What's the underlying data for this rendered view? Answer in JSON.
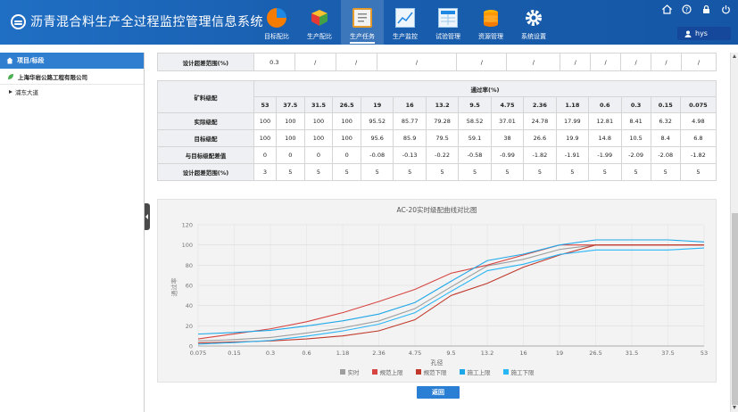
{
  "header": {
    "title": "沥青混合料生产全过程监控管理信息系统",
    "nav": [
      {
        "label": "目标配比",
        "icon": "pie-chart-icon"
      },
      {
        "label": "生产配比",
        "icon": "cube-icon"
      },
      {
        "label": "生产任务",
        "icon": "clipboard-icon"
      },
      {
        "label": "生产监控",
        "icon": "line-chart-icon"
      },
      {
        "label": "试验管理",
        "icon": "table-icon"
      },
      {
        "label": "资源管理",
        "icon": "database-icon"
      },
      {
        "label": "系统设置",
        "icon": "gear-icon"
      }
    ],
    "user": "hys"
  },
  "sidebar": {
    "title": "项目/标段",
    "org": "上海华岩公路工程有限公司",
    "items": [
      {
        "label": "浦东大道"
      }
    ]
  },
  "top_row": {
    "label": "设计超差范围(%)",
    "values": [
      "0.3",
      "/",
      "/",
      "/",
      "/",
      "/",
      "/",
      "/",
      "/",
      "/",
      "/"
    ]
  },
  "grading_table": {
    "head_left": "矿料级配",
    "head_group": "通过率(%)",
    "sieves": [
      "53",
      "37.5",
      "31.5",
      "26.5",
      "19",
      "16",
      "13.2",
      "9.5",
      "4.75",
      "2.36",
      "1.18",
      "0.6",
      "0.3",
      "0.15",
      "0.075"
    ],
    "rows": [
      {
        "label": "实际级配",
        "values": [
          "100",
          "100",
          "100",
          "100",
          "95.52",
          "85.77",
          "79.28",
          "58.52",
          "37.01",
          "24.78",
          "17.99",
          "12.81",
          "8.41",
          "6.32",
          "4.98"
        ]
      },
      {
        "label": "目标级配",
        "values": [
          "100",
          "100",
          "100",
          "100",
          "95.6",
          "85.9",
          "79.5",
          "59.1",
          "38",
          "26.6",
          "19.9",
          "14.8",
          "10.5",
          "8.4",
          "6.8"
        ]
      },
      {
        "label": "与目标级配差值",
        "values": [
          "0",
          "0",
          "0",
          "0",
          "-0.08",
          "-0.13",
          "-0.22",
          "-0.58",
          "-0.99",
          "-1.82",
          "-1.91",
          "-1.99",
          "-2.09",
          "-2.08",
          "-1.82"
        ]
      },
      {
        "label": "设计超差范围(%)",
        "values": [
          "3",
          "5",
          "5",
          "5",
          "5",
          "5",
          "5",
          "5",
          "5",
          "5",
          "5",
          "5",
          "5",
          "5",
          "5"
        ]
      }
    ]
  },
  "chart_data": {
    "type": "line",
    "title": "AC-20实时级配曲线对比图",
    "xlabel": "孔径",
    "ylabel": "通过率",
    "categories": [
      "0.075",
      "0.15",
      "0.3",
      "0.6",
      "1.18",
      "2.36",
      "4.75",
      "9.5",
      "13.2",
      "16",
      "19",
      "26.5",
      "31.5",
      "37.5",
      "53"
    ],
    "ylim": [
      0,
      120
    ],
    "yticks": [
      0,
      20,
      40,
      60,
      80,
      100,
      120
    ],
    "series": [
      {
        "name": "实时",
        "color": "#9e9e9e",
        "values": [
          4.98,
          6.32,
          8.41,
          12.81,
          17.99,
          24.78,
          37.01,
          58.52,
          79.28,
          85.77,
          95.52,
          100,
          100,
          100,
          100
        ]
      },
      {
        "name": "規范上限",
        "color": "#d64541",
        "values": [
          7,
          12,
          17,
          24,
          33,
          44,
          56,
          72,
          80,
          90,
          100,
          100,
          100,
          100,
          100
        ]
      },
      {
        "name": "規范下限",
        "color": "#c0392b",
        "values": [
          3,
          4,
          5,
          7,
          10,
          15,
          26,
          50,
          62,
          78,
          90,
          100,
          100,
          100,
          100
        ]
      },
      {
        "name": "施工上限",
        "color": "#1ea7e8",
        "values": [
          11.8,
          13.4,
          15.5,
          19.8,
          24.9,
          31.6,
          43,
          64.1,
          84.5,
          90.9,
          100,
          105,
          105,
          105,
          103
        ]
      },
      {
        "name": "施工下限",
        "color": "#29b6f6",
        "values": [
          1.8,
          3.4,
          5.5,
          9.8,
          14.9,
          21.6,
          33,
          54.1,
          74.5,
          80.9,
          90.6,
          95,
          95,
          95,
          97
        ]
      }
    ],
    "grid": true,
    "legend": "bottom"
  },
  "buttons": {
    "back": "返回"
  }
}
